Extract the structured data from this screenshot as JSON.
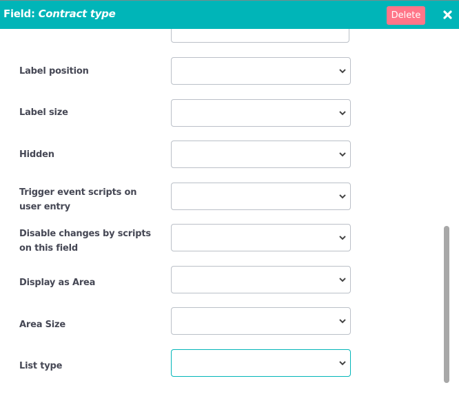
{
  "header": {
    "title_prefix": "Field: ",
    "title_name": "Contract type",
    "delete_label": "Delete",
    "close_icon": "close-icon",
    "background": "#00b5b8",
    "delete_color": "#ff7588"
  },
  "fields": [
    {
      "label": "Label position",
      "value": "",
      "focused": false
    },
    {
      "label": "Label size",
      "value": "",
      "focused": false
    },
    {
      "label": "Hidden",
      "value": "",
      "focused": false
    },
    {
      "label": "Trigger event scripts on user entry",
      "value": "",
      "focused": false
    },
    {
      "label": "Disable changes by scripts on this field",
      "value": "",
      "focused": false
    },
    {
      "label": "Display as Area",
      "value": "",
      "focused": false
    },
    {
      "label": "Area Size",
      "value": "",
      "focused": false
    },
    {
      "label": "List type",
      "value": "",
      "focused": true
    }
  ]
}
